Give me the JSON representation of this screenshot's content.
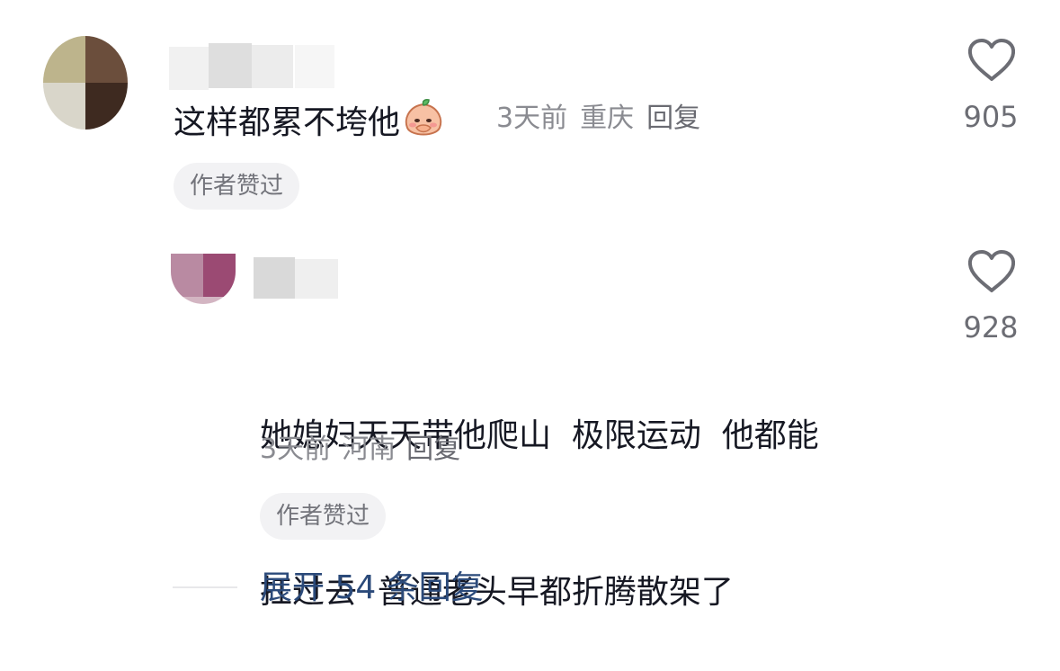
{
  "comment": {
    "username": "",
    "text": "这样都累不垮他",
    "emoji": "shy-peach-emoji",
    "time": "3天前",
    "location": "重庆",
    "reply_label": "回复",
    "badge": "作者赞过",
    "like_count": "905"
  },
  "reply": {
    "username": "",
    "text_lines": [
      "她媳妇天天带他爬山  极限运动  他都能",
      "扛过去  普通老头早都折腾散架了"
    ],
    "time": "3天前",
    "location": "河南",
    "reply_label": "回复",
    "badge": "作者赞过",
    "like_count": "928"
  },
  "expand": {
    "label": "展开 54 条回复"
  },
  "colors": {
    "text_primary": "#161823",
    "text_secondary": "#8a8b91",
    "badge_bg": "#f2f2f4",
    "link_blue": "#2b4a7a",
    "icon_stroke": "#6c6d74"
  }
}
